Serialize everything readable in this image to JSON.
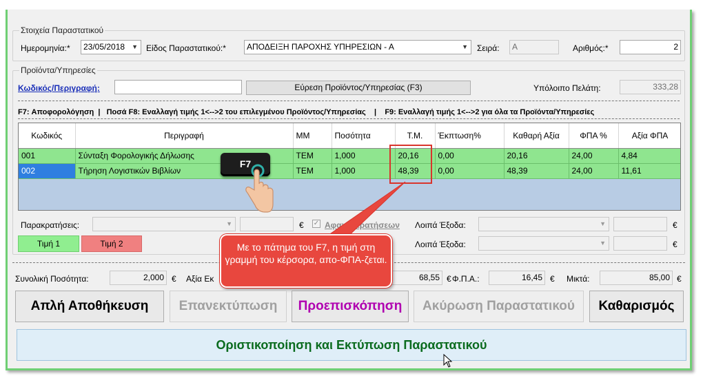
{
  "colors": {
    "accent_green": "#6fcf74",
    "row_green": "#8fe58f",
    "selected_blue": "#2f7fe0",
    "callout_red": "#e8473e",
    "preview_purple": "#b000b0",
    "finalize_green": "#0a6b1e"
  },
  "doc": {
    "group_title": "Στοιχεία Παραστατικού",
    "date_label": "Ημερομηνία:*",
    "date_value": "23/05/2018",
    "type_label": "Είδος Παραστατικού:*",
    "type_value": "ΑΠΟΔΕΙΞΗ ΠΑΡΟΧΗΣ ΥΠΗΡΕΣΙΩΝ - Α",
    "series_label": "Σειρά:",
    "series_value": "A",
    "number_label": "Αριθμός:*",
    "number_value": "2"
  },
  "products": {
    "group_title": "Προϊόντα/Υπηρεσίες",
    "code_link": "Κωδικός/Περιγραφή:",
    "code_value": "",
    "find_button": "Εύρεση Προϊόντος/Υπηρεσίας (F3)",
    "balance_label": "Υπόλοιπο Πελάτη:",
    "balance_value": "333,28"
  },
  "hints": {
    "f7": "F7: Αποφορολόγηση",
    "f8": "Ποσά F8: Εναλλαγή τιμής 1<-->2 του επιλεγμένου Προϊόντος/Υπηρεσίας",
    "f9": "F9: Εναλλαγή τιμής 1<-->2 για όλα τα Προϊόντα/Υπηρεσίες"
  },
  "table": {
    "headers": [
      "Κωδικός",
      "Περιγραφή",
      "ΜΜ",
      "Ποσότητα",
      "Τ.Μ.",
      "Έκπτωση%",
      "Καθαρή Αξία",
      "ΦΠΑ %",
      "Αξία ΦΠΑ"
    ],
    "rows": [
      [
        "001",
        "Σύνταξη Φορολογικής Δήλωσης",
        "ΤΕΜ",
        "1,000",
        "20,16",
        "0,00",
        "20,16",
        "24,00",
        "4,84"
      ],
      [
        "002",
        "Τήρηση Λογιστικών Βιβλίων",
        "ΤΕΜ",
        "1,000",
        "48,39",
        "0,00",
        "48,39",
        "24,00",
        "11,61"
      ]
    ]
  },
  "withholding": {
    "label": "Παρακρατήσεις:",
    "combo_value": "",
    "amount_value": "",
    "currency": "€",
    "checkbox_label": "Αφαιρ. Κρατήσεων",
    "checkbox_checked": true
  },
  "other_expenses": [
    {
      "label": "Λοιπά Έξοδα:",
      "value": "",
      "amount": "",
      "currency": "€"
    },
    {
      "label": "Λοιπά Έξοδα:",
      "value": "",
      "amount": "",
      "currency": "€"
    }
  ],
  "price_buttons": {
    "price1": "Τιμή 1",
    "price2": "Τιμή 2"
  },
  "totals": {
    "qty_label": "Συνολική Ποσότητα:",
    "qty_value": "2,000",
    "net_label": "Αξία Εκ",
    "net_value": "68,55",
    "vat_label": "Φ.Π.Α.:",
    "vat_value": "16,45",
    "gross_label": "Μικτά:",
    "gross_value": "85,00",
    "currency": "€"
  },
  "actions": {
    "save": "Απλή Αποθήκευση",
    "reprint": "Επανεκτύπωση",
    "preview": "Προεπισκόπηση",
    "cancel_doc": "Ακύρωση Παραστατικού",
    "clear": "Καθαρισμός",
    "finalize": "Οριστικοποίηση και Εκτύπωση Παραστατικού"
  },
  "annotation": {
    "key_label": "F7",
    "callout_text": "Με το πάτημα του F7, η τιμή στη γραμμή του κέρσορα, απο-ΦΠΑ-ζεται."
  }
}
